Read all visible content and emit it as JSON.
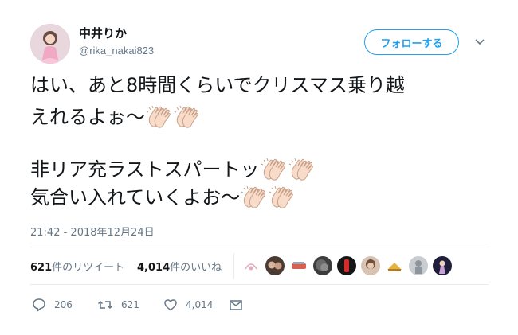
{
  "user": {
    "display_name": "中井りか",
    "handle": "@rika_nakai823",
    "avatar_icon": "profile-avatar"
  },
  "header": {
    "follow_label": "フォローする",
    "menu_icon": "chevron-down-icon"
  },
  "tweet": {
    "lines": [
      "はい、あと8時間くらいでクリスマス乗り越",
      "えれるよぉ～",
      "非リア充ラストスパートッ",
      "気合い入れていくよお～"
    ],
    "emoji": "clapping-hands-icon",
    "timestamp": "21:42 - 2018年12月24日"
  },
  "stats": {
    "retweets_count": "621",
    "retweets_label": "件のリツイート",
    "likes_count": "4,014",
    "likes_label": "件のいいね"
  },
  "actions": {
    "reply_count": "206",
    "retweet_count": "621",
    "like_count": "4,014"
  },
  "colors": {
    "accent": "#1da1f2",
    "secondary_text": "#657786",
    "divider": "#e6ecf0"
  }
}
